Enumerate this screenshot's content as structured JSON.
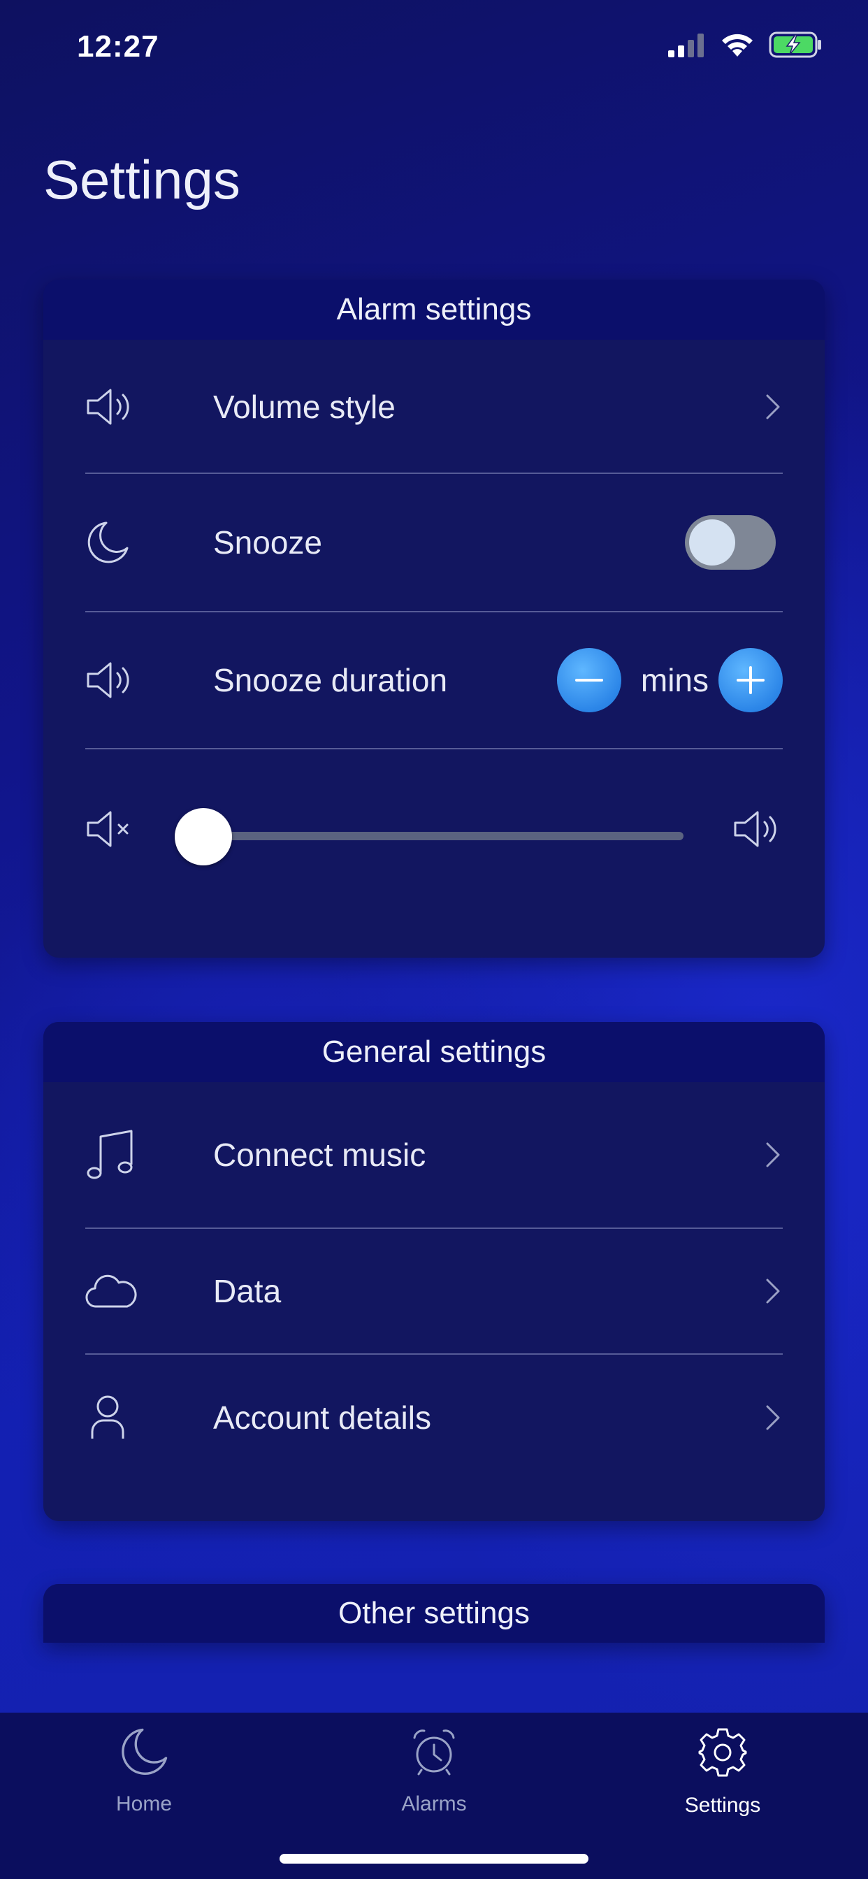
{
  "status_bar": {
    "time": "12:27",
    "icons": [
      "signal-icon",
      "wifi-icon",
      "battery-charging-icon"
    ],
    "battery_color": "#4cd964"
  },
  "page_title": "Settings",
  "alarm_settings": {
    "header": "Alarm settings",
    "volume_style": {
      "label": "Volume style",
      "icon": "speaker-icon"
    },
    "snooze": {
      "label": "Snooze",
      "icon": "moon-icon",
      "enabled": false
    },
    "snooze_duration": {
      "label": "Snooze duration",
      "icon": "speaker-icon",
      "unit": "mins"
    },
    "volume_slider": {
      "value": 0
    }
  },
  "general_settings": {
    "header": "General settings",
    "items": [
      {
        "label": "Connect music",
        "icon": "music-note-icon"
      },
      {
        "label": "Data",
        "icon": "cloud-icon"
      },
      {
        "label": "Account details",
        "icon": "user-icon"
      }
    ]
  },
  "other_settings": {
    "header": "Other settings"
  },
  "tab_bar": {
    "tabs": [
      {
        "label": "Home",
        "icon": "moon-icon",
        "active": false
      },
      {
        "label": "Alarms",
        "icon": "alarm-clock-icon",
        "active": false
      },
      {
        "label": "Settings",
        "icon": "gear-icon",
        "active": true
      }
    ],
    "active_color": "#ffffff",
    "inactive_color": "#9aa3c7"
  }
}
